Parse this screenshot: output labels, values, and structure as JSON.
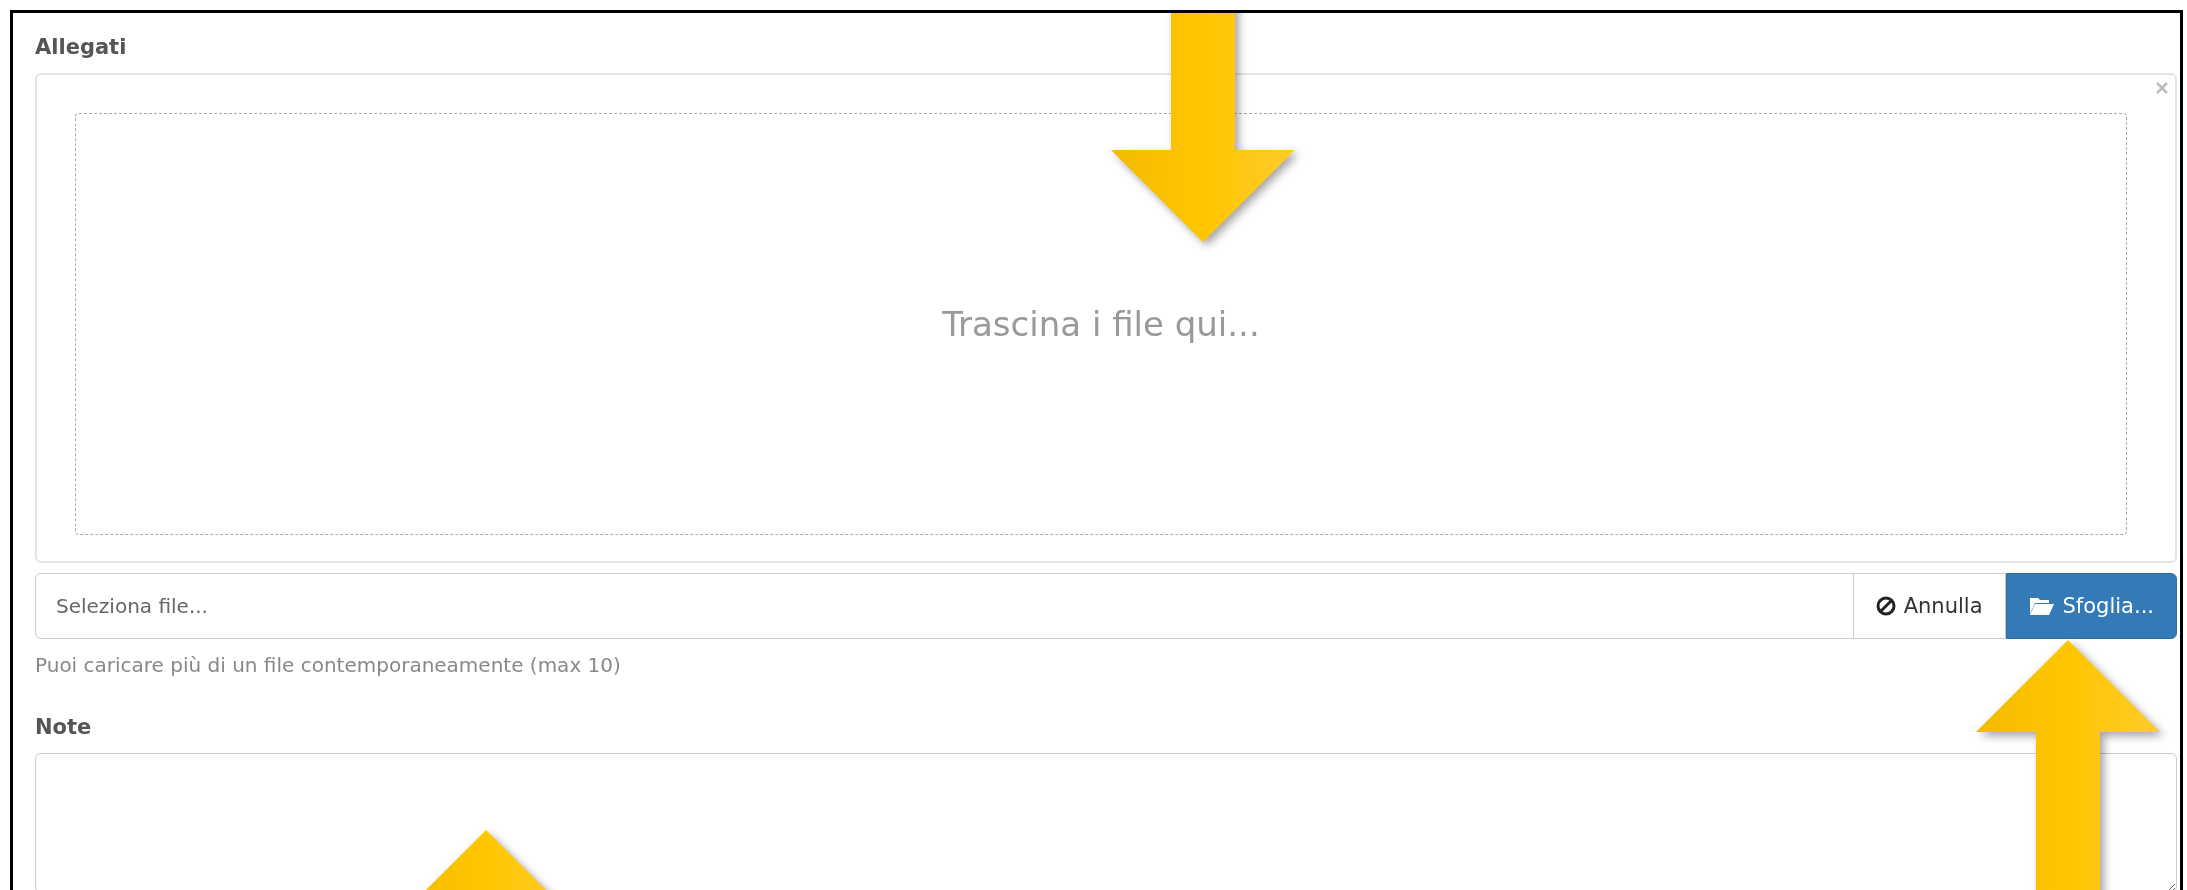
{
  "attachments": {
    "label": "Allegati",
    "dropzone_text": "Trascina i file qui...",
    "file_field": {
      "placeholder": "Seleziona file..."
    },
    "buttons": [
      {
        "kind": "cancel",
        "label": "Annulla"
      },
      {
        "kind": "browse",
        "label": "Sfoglia..."
      }
    ],
    "help_text": "Puoi caricare più di un file contemporaneamente (max 10)"
  },
  "note": {
    "label": "Note"
  }
}
